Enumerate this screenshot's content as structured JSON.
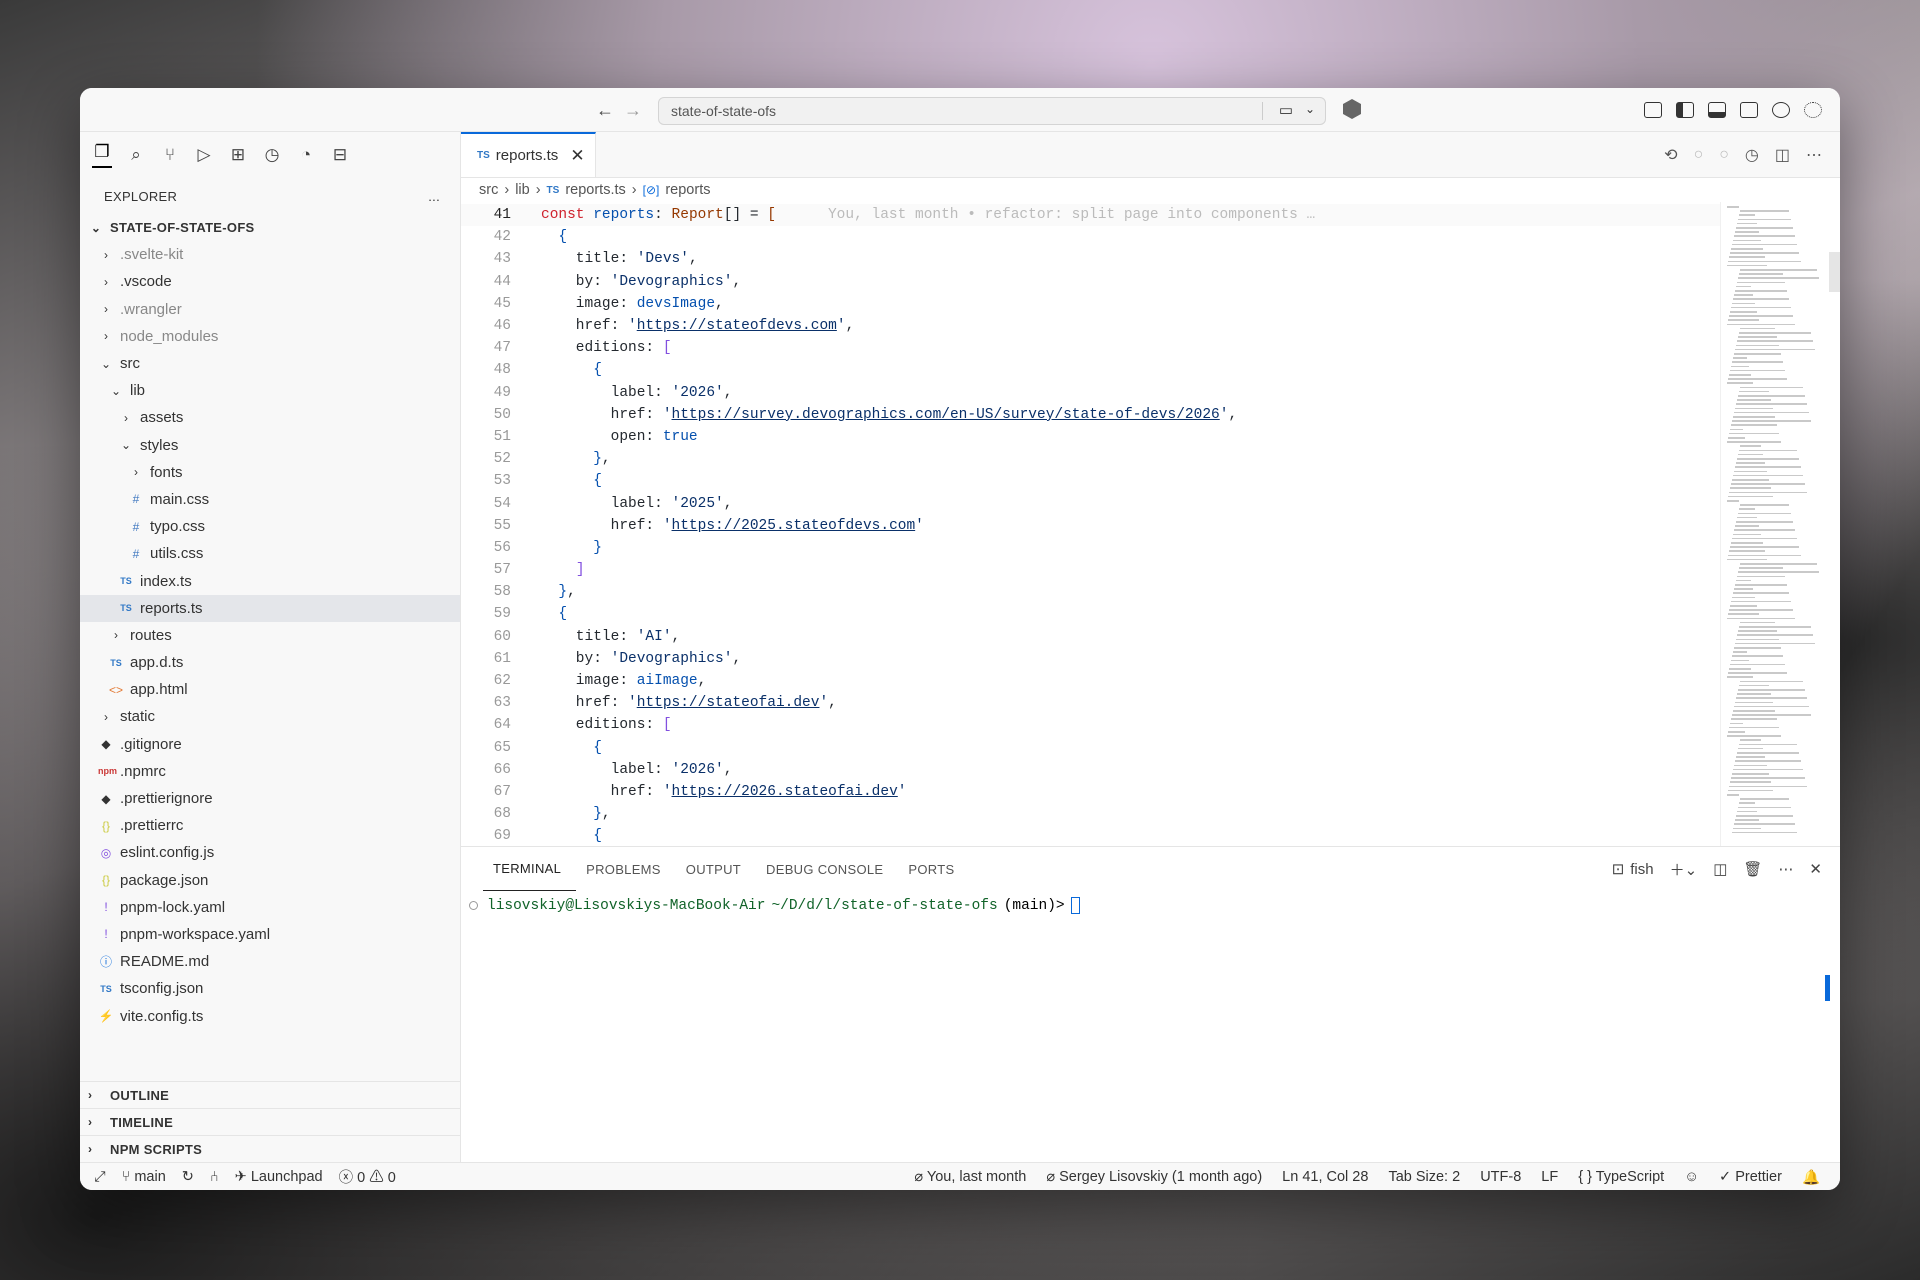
{
  "titlebar": {
    "search": "state-of-state-ofs"
  },
  "explorer": {
    "title": "EXPLORER",
    "more": "...",
    "root": "STATE-OF-STATE-OFS",
    "items": [
      {
        "label": ".svelte-kit",
        "ic": "›",
        "dim": true,
        "d": 1
      },
      {
        "label": ".vscode",
        "ic": "›",
        "dim": false,
        "d": 1
      },
      {
        "label": ".wrangler",
        "ic": "›",
        "dim": true,
        "d": 1
      },
      {
        "label": "node_modules",
        "ic": "›",
        "dim": true,
        "d": 1
      },
      {
        "label": "src",
        "ic": "⌄",
        "dim": false,
        "d": 1
      },
      {
        "label": "lib",
        "ic": "⌄",
        "dim": false,
        "d": 2
      },
      {
        "label": "assets",
        "ic": "›",
        "dim": false,
        "d": 3
      },
      {
        "label": "styles",
        "ic": "⌄",
        "dim": false,
        "d": 3
      },
      {
        "label": "fonts",
        "ic": "›",
        "dim": false,
        "d": 4
      },
      {
        "label": "main.css",
        "ic": "#",
        "dim": false,
        "d": 4
      },
      {
        "label": "typo.css",
        "ic": "#",
        "dim": false,
        "d": 4
      },
      {
        "label": "utils.css",
        "ic": "#",
        "dim": false,
        "d": 4
      },
      {
        "label": "index.ts",
        "ic": "TS",
        "dim": false,
        "d": 3
      },
      {
        "label": "reports.ts",
        "ic": "TS",
        "dim": false,
        "d": 3,
        "sel": true
      },
      {
        "label": "routes",
        "ic": "›",
        "dim": false,
        "d": 2
      },
      {
        "label": "app.d.ts",
        "ic": "TS",
        "dim": false,
        "d": 2
      },
      {
        "label": "app.html",
        "ic": "<>",
        "dim": false,
        "d": 2
      },
      {
        "label": "static",
        "ic": "›",
        "dim": false,
        "d": 1
      },
      {
        "label": ".gitignore",
        "ic": "◆",
        "dim": false,
        "d": 1
      },
      {
        "label": ".npmrc",
        "ic": "npm",
        "dim": false,
        "d": 1
      },
      {
        "label": ".prettierignore",
        "ic": "◆",
        "dim": false,
        "d": 1
      },
      {
        "label": ".prettierrc",
        "ic": "{}",
        "dim": false,
        "d": 1
      },
      {
        "label": "eslint.config.js",
        "ic": "◎",
        "dim": false,
        "d": 1
      },
      {
        "label": "package.json",
        "ic": "{}",
        "dim": false,
        "d": 1
      },
      {
        "label": "pnpm-lock.yaml",
        "ic": "!",
        "dim": false,
        "d": 1
      },
      {
        "label": "pnpm-workspace.yaml",
        "ic": "!",
        "dim": false,
        "d": 1
      },
      {
        "label": "README.md",
        "ic": "ⓘ",
        "dim": false,
        "d": 1
      },
      {
        "label": "tsconfig.json",
        "ic": "TS",
        "dim": false,
        "d": 1
      },
      {
        "label": "vite.config.ts",
        "ic": "⚡",
        "dim": false,
        "d": 1
      }
    ],
    "sections": [
      "OUTLINE",
      "TIMELINE",
      "NPM SCRIPTS"
    ]
  },
  "tab": {
    "label": "reports.ts",
    "lang": "TS"
  },
  "breadcrumb": {
    "a": "src",
    "b": "lib",
    "c": "reports.ts",
    "d": "reports"
  },
  "blame": "You, last month • refactor: split page into components …",
  "code": [
    [
      41,
      [
        [
          "const ",
          "k"
        ],
        [
          "reports",
          "v"
        ],
        [
          ": ",
          "p"
        ],
        [
          "Report",
          "ty"
        ],
        [
          "[] = ",
          "p"
        ],
        [
          "[",
          "b1"
        ]
      ]
    ],
    [
      42,
      [
        [
          "  ",
          "p"
        ],
        [
          "{",
          "b2"
        ]
      ]
    ],
    [
      43,
      [
        [
          "    title: ",
          "p"
        ],
        [
          "'Devs'",
          "s"
        ],
        [
          ",",
          "p"
        ]
      ]
    ],
    [
      44,
      [
        [
          "    by: ",
          "p"
        ],
        [
          "'Devographics'",
          "s"
        ],
        [
          ",",
          "p"
        ]
      ]
    ],
    [
      45,
      [
        [
          "    image: ",
          "p"
        ],
        [
          "devsImage",
          "v"
        ],
        [
          ",",
          "p"
        ]
      ]
    ],
    [
      46,
      [
        [
          "    href: ",
          "p"
        ],
        [
          "'",
          "s"
        ],
        [
          "https://stateofdevs.com",
          "su"
        ],
        [
          "'",
          "s"
        ],
        [
          ",",
          "p"
        ]
      ]
    ],
    [
      47,
      [
        [
          "    editions: ",
          "p"
        ],
        [
          "[",
          "b3"
        ]
      ]
    ],
    [
      48,
      [
        [
          "      ",
          "p"
        ],
        [
          "{",
          "b2"
        ]
      ]
    ],
    [
      49,
      [
        [
          "        label: ",
          "p"
        ],
        [
          "'2026'",
          "s"
        ],
        [
          ",",
          "p"
        ]
      ]
    ],
    [
      50,
      [
        [
          "        href: ",
          "p"
        ],
        [
          "'",
          "s"
        ],
        [
          "https://survey.devographics.com/en-US/survey/state-of-devs/2026",
          "su"
        ],
        [
          "'",
          "s"
        ],
        [
          ",",
          "p"
        ]
      ]
    ],
    [
      51,
      [
        [
          "        open: ",
          "p"
        ],
        [
          "true",
          "v"
        ]
      ]
    ],
    [
      52,
      [
        [
          "      ",
          "p"
        ],
        [
          "}",
          "b2"
        ],
        [
          ",",
          "p"
        ]
      ]
    ],
    [
      53,
      [
        [
          "      ",
          "p"
        ],
        [
          "{",
          "b2"
        ]
      ]
    ],
    [
      54,
      [
        [
          "        label: ",
          "p"
        ],
        [
          "'2025'",
          "s"
        ],
        [
          ",",
          "p"
        ]
      ]
    ],
    [
      55,
      [
        [
          "        href: ",
          "p"
        ],
        [
          "'",
          "s"
        ],
        [
          "https://2025.stateofdevs.com",
          "su"
        ],
        [
          "'",
          "s"
        ]
      ]
    ],
    [
      56,
      [
        [
          "      ",
          "p"
        ],
        [
          "}",
          "b2"
        ]
      ]
    ],
    [
      57,
      [
        [
          "    ",
          "p"
        ],
        [
          "]",
          "b3"
        ]
      ]
    ],
    [
      58,
      [
        [
          "  ",
          "p"
        ],
        [
          "}",
          "b2"
        ],
        [
          ",",
          "p"
        ]
      ]
    ],
    [
      59,
      [
        [
          "  ",
          "p"
        ],
        [
          "{",
          "b2"
        ]
      ]
    ],
    [
      60,
      [
        [
          "    title: ",
          "p"
        ],
        [
          "'AI'",
          "s"
        ],
        [
          ",",
          "p"
        ]
      ]
    ],
    [
      61,
      [
        [
          "    by: ",
          "p"
        ],
        [
          "'Devographics'",
          "s"
        ],
        [
          ",",
          "p"
        ]
      ]
    ],
    [
      62,
      [
        [
          "    image: ",
          "p"
        ],
        [
          "aiImage",
          "v"
        ],
        [
          ",",
          "p"
        ]
      ]
    ],
    [
      63,
      [
        [
          "    href: ",
          "p"
        ],
        [
          "'",
          "s"
        ],
        [
          "https://stateofai.dev",
          "su"
        ],
        [
          "'",
          "s"
        ],
        [
          ",",
          "p"
        ]
      ]
    ],
    [
      64,
      [
        [
          "    editions: ",
          "p"
        ],
        [
          "[",
          "b3"
        ]
      ]
    ],
    [
      65,
      [
        [
          "      ",
          "p"
        ],
        [
          "{",
          "b2"
        ]
      ]
    ],
    [
      66,
      [
        [
          "        label: ",
          "p"
        ],
        [
          "'2026'",
          "s"
        ],
        [
          ",",
          "p"
        ]
      ]
    ],
    [
      67,
      [
        [
          "        href: ",
          "p"
        ],
        [
          "'",
          "s"
        ],
        [
          "https://2026.stateofai.dev",
          "su"
        ],
        [
          "'",
          "s"
        ]
      ]
    ],
    [
      68,
      [
        [
          "      ",
          "p"
        ],
        [
          "}",
          "b2"
        ],
        [
          ",",
          "p"
        ]
      ]
    ],
    [
      69,
      [
        [
          "      ",
          "p"
        ],
        [
          "{",
          "b2"
        ]
      ]
    ]
  ],
  "panel": {
    "tabs": [
      "TERMINAL",
      "PROBLEMS",
      "OUTPUT",
      "DEBUG CONSOLE",
      "PORTS"
    ],
    "shell": "fish",
    "prompt_user": "lisovskiy@Lisovskiys-MacBook-Air",
    "prompt_path": "~/D/d/l/state-of-state-ofs",
    "prompt_branch": "(main)>"
  },
  "status": {
    "branch": "main",
    "launchpad": "Launchpad",
    "errors": "0",
    "warnings": "0",
    "blame": "You, last month",
    "author": "Sergey Lisovskiy (1 month ago)",
    "pos": "Ln 41, Col 28",
    "tab": "Tab Size: 2",
    "enc": "UTF-8",
    "eol": "LF",
    "lang": "TypeScript",
    "fmt": "Prettier"
  }
}
